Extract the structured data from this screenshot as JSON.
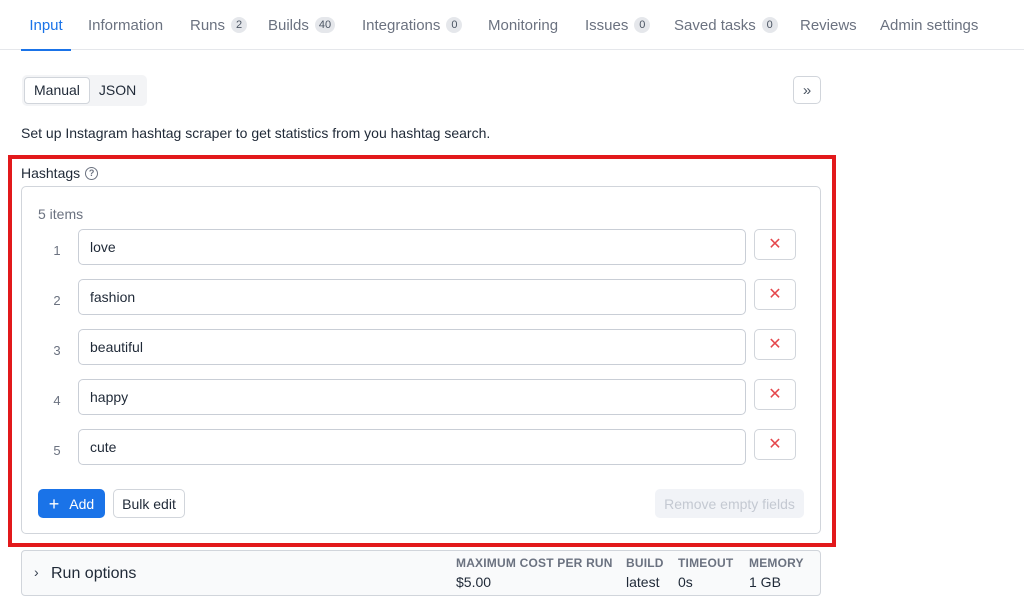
{
  "tabs": [
    {
      "label": "Input",
      "badge": null
    },
    {
      "label": "Information",
      "badge": null
    },
    {
      "label": "Runs",
      "badge": "2"
    },
    {
      "label": "Builds",
      "badge": "40"
    },
    {
      "label": "Integrations",
      "badge": "0"
    },
    {
      "label": "Monitoring",
      "badge": null
    },
    {
      "label": "Issues",
      "badge": "0"
    },
    {
      "label": "Saved tasks",
      "badge": "0"
    },
    {
      "label": "Reviews",
      "badge": null
    },
    {
      "label": "Admin settings",
      "badge": null
    }
  ],
  "active_tab": "Input",
  "mode": {
    "manual_label": "Manual",
    "json_label": "JSON",
    "active": "Manual",
    "expand_glyph": "»"
  },
  "description": "Set up Instagram hashtag scraper to get statistics from you hashtag search.",
  "hashtags": {
    "label": "Hashtags",
    "help_glyph": "?",
    "count": "5 items",
    "items": [
      {
        "index": "1",
        "value": "love"
      },
      {
        "index": "2",
        "value": "fashion"
      },
      {
        "index": "3",
        "value": "beautiful"
      },
      {
        "index": "4",
        "value": "happy"
      },
      {
        "index": "5",
        "value": "cute"
      }
    ],
    "remove_glyph": "✕",
    "add_label": "Add",
    "add_glyph": "+",
    "bulk_edit_label": "Bulk edit",
    "remove_empty_label": "Remove empty fields"
  },
  "run_options": {
    "title": "Run options",
    "chevron_glyph": "›",
    "max_cost_label": "MAXIMUM COST PER RUN",
    "max_cost_value": "$5.00",
    "build_label": "BUILD",
    "build_value": "latest",
    "timeout_label": "TIMEOUT",
    "timeout_value": "0s",
    "memory_label": "MEMORY",
    "memory_value": "1 GB"
  },
  "colors": {
    "accent": "#1a73e8",
    "highlight": "#e2191b",
    "danger": "#e5484d"
  }
}
